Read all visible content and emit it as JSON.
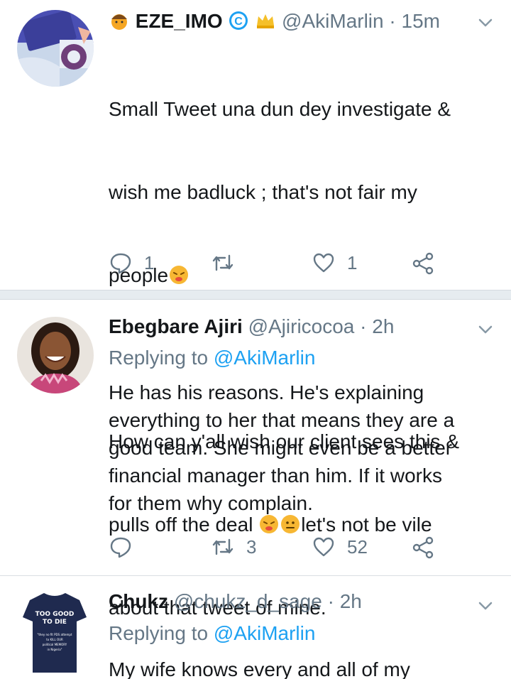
{
  "tweets": [
    {
      "name": "EZE_IMO",
      "badges": [
        "person-emoji-icon",
        "copyright-badge-icon",
        "crown-emoji-icon"
      ],
      "handle": "@AkiMarlin",
      "dot": "·",
      "time": "15m",
      "text_lines": [
        "Small Tweet una dun dey investigate &",
        "wish me badluck ; that's not fair my",
        "people"
      ],
      "text_lines_2": [
        "How can y'all wish our client sees this &",
        "pulls off the deal",
        "let's not be vile",
        "about that tweet of mine."
      ],
      "reply_count": "1",
      "retweet_count": "",
      "like_count": "1"
    },
    {
      "name": "Ebegbare Ajiri",
      "handle": "@Ajiricocoa",
      "dot": "·",
      "time": "2h",
      "replying_prefix": "Replying to",
      "replying_to": "@AkiMarlin",
      "text": "He has his reasons. He's explaining\neverything to her that means they are a\ngood team. She might even be a better\nfinancial manager than him. If it works\nfor them why complain.",
      "reply_count": "",
      "retweet_count": "3",
      "like_count": "52"
    },
    {
      "name": "Chukz",
      "handle": "@chukz_d_sage",
      "dot": "·",
      "time": "2h",
      "replying_prefix": "Replying to",
      "replying_to": "@AkiMarlin",
      "text": "My wife knows every and all of my",
      "shirt_text_big": [
        "TOO GOOD",
        "TO DIE"
      ],
      "shirt_text_small": [
        "\"they no fit PDS attempt",
        "to KILL OUR",
        "political MEMORY",
        "in Nigeria\""
      ]
    }
  ],
  "colors": {
    "text": "#14171a",
    "muted": "#657786",
    "link": "#1da1f2",
    "divider": "#e6ecf0"
  }
}
